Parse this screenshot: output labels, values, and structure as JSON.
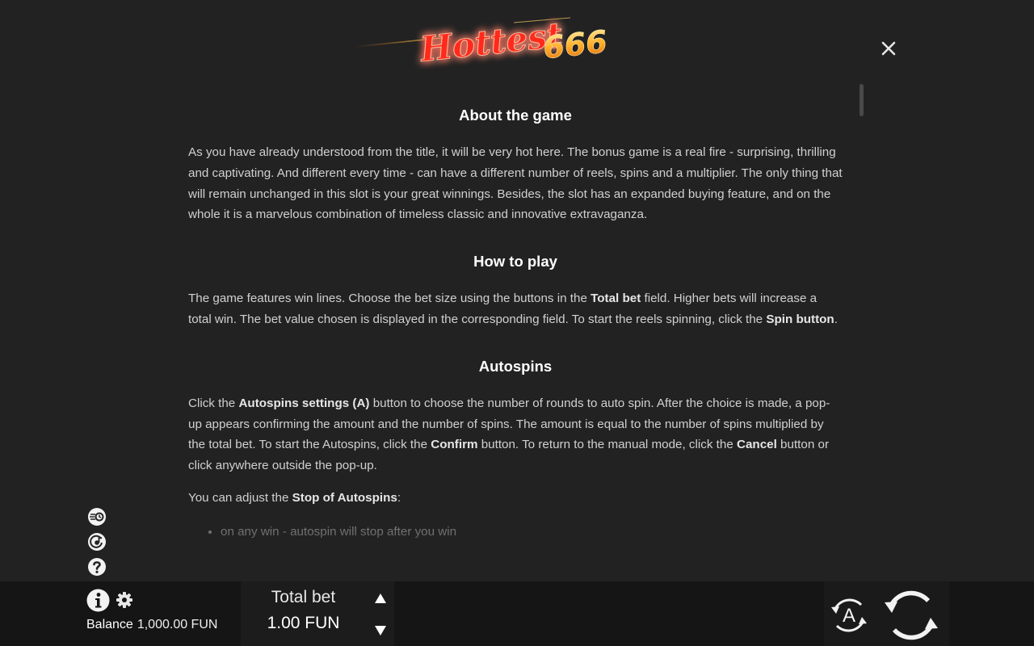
{
  "logo": {
    "text": "Hottest",
    "number": "666"
  },
  "close": {
    "symbol": "×"
  },
  "sections": [
    {
      "title": "About the game",
      "text": "As you have already understood from the title, it will be very hot here. The bonus game is a real fire - surprising, thrilling and captivating. And different every time - can have a different number of reels, spins and a multiplier. The only thing that will remain unchanged in this slot is your great winnings. Besides, the slot has an expanded buying feature, and on the whole it is a marvelous combination of timeless classic and innovative extravaganza."
    },
    {
      "title": "How to play",
      "p1": "The game features win lines. Choose the bet size using the buttons in the ",
      "b1": "Total bet",
      "p2": " field. Higher bets will increase a total win. The bet value chosen is displayed in the corresponding field. To start the reels spinning, click the ",
      "b2": "Spin button",
      "p3": "."
    },
    {
      "title": "Autospins",
      "p1": "Click the ",
      "b1": "Autospins settings (A)",
      "p2": " button to choose the number of rounds to auto spin. After the choice is made, a pop-up appears confirming the amount and the number of spins. The amount is equal to the number of spins multiplied by the total bet. To start the Autospins, click the ",
      "b2": "Confirm",
      "p3": " button. To return to the manual mode, click the ",
      "b3": "Cancel",
      "p4": " button or click anywhere outside the pop-up.",
      "stop_p1": "You can adjust the ",
      "stop_b": "Stop of Autospins",
      "stop_p2": ":",
      "bullets": [
        "on any win - autospin will stop after you win"
      ]
    }
  ],
  "side_icons": [
    "fast-spin-icon",
    "sound-icon",
    "help-icon"
  ],
  "bottom": {
    "balance_label": "Balance",
    "balance_value": "1,000.00 FUN",
    "bet_label": "Total bet",
    "bet_value": "1.00 FUN",
    "auto_label": "A"
  },
  "colors": {
    "background": "#222222",
    "bar": "#151515",
    "logo_red": "#ff2a1a",
    "logo_gold": "#ffb22a"
  }
}
